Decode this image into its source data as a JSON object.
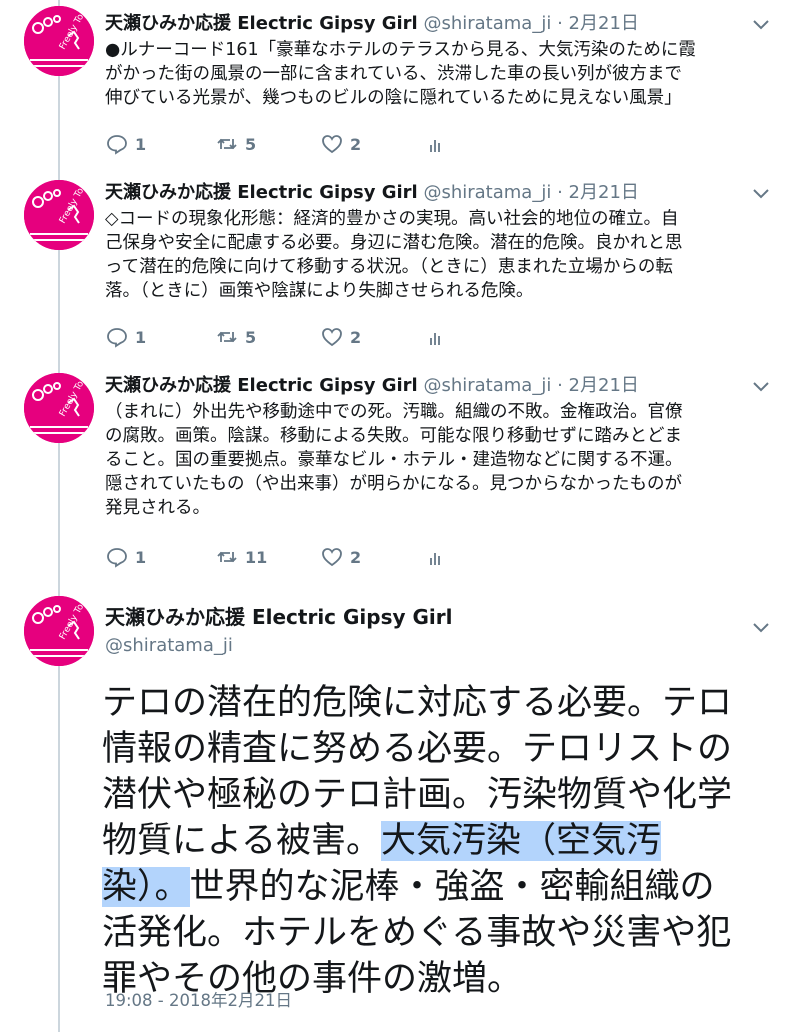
{
  "author": {
    "name": "天瀬ひみか応援 Electric Gipsy Girl",
    "handle": "@shiratama_ji",
    "avatar_text": "Freely Tomorrow",
    "avatar_color": "#e6007e"
  },
  "tweets": [
    {
      "separator": "·",
      "date": "2月21日",
      "lines": [
        "●ルナーコード161「豪華なホテルのテラスから見る、大気汚染のために霞",
        "がかった街の風景の一部に含まれている、渋滞した車の長い列が彼方まで",
        "伸びている光景が、幾つものビルの陰に隠れているために見えない風景」"
      ],
      "replies": "1",
      "retweets": "5",
      "likes": "2"
    },
    {
      "separator": "·",
      "date": "2月21日",
      "lines": [
        "◇コードの現象化形態：経済的豊かさの実現。高い社会的地位の確立。自",
        "己保身や安全に配慮する必要。身辺に潜む危険。潜在的危険。良かれと思",
        "って潜在的危険に向けて移動する状況。（ときに）恵まれた立場からの転",
        "落。（ときに）画策や陰謀により失脚させられる危険。"
      ],
      "replies": "1",
      "retweets": "5",
      "likes": "2"
    },
    {
      "separator": "·",
      "date": "2月21日",
      "lines": [
        "（まれに）外出先や移動途中での死。汚職。組織の不敗。金権政治。官僚",
        "の腐敗。画策。陰謀。移動による失敗。可能な限り移動せずに踏みとどま",
        "ること。国の重要拠点。豪華なビル・ホテル・建造物などに関する不運。",
        "隠されていたもの（や出来事）が明らかになる。見つからなかったものが",
        "発見される。"
      ],
      "replies": "1",
      "retweets": "11",
      "likes": "2"
    }
  ],
  "main_tweet": {
    "line1": "テロの潜在的危険に対応する必要。テロ",
    "line2": "情報の精査に努める必要。テロリストの",
    "line3": "潜伏や極秘のテロ計画。汚染物質や化学",
    "line4_plain": "物質による被害。",
    "line4_highlight": "大気汚染（空気汚",
    "line5_highlight": "染）。",
    "line5_plain": "世界的な泥棒・強盗・密輸組織の",
    "line6": "活発化。ホテルをめぐる事故や災害や犯",
    "line7": "罪やその他の事件の激増。",
    "timestamp": "19:08 - 2018年2月21日",
    "highlight_color": "#b3d4fc"
  },
  "icons": {
    "reply": "reply-bubble-icon",
    "retweet": "retweet-arrows-icon",
    "like": "heart-icon",
    "analytics": "bar-chart-icon",
    "more": "chevron-down-icon"
  }
}
